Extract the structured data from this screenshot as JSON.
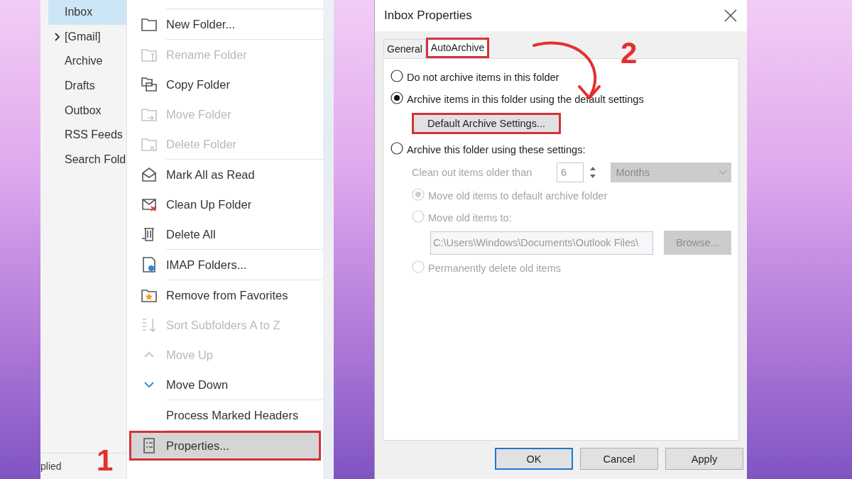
{
  "folder_pane": {
    "folders": [
      {
        "label": "Inbox",
        "selected": true,
        "kind": "folder"
      },
      {
        "label": "[Gmail]",
        "selected": false,
        "kind": "group"
      },
      {
        "label": "Archive",
        "selected": false,
        "kind": "folder"
      },
      {
        "label": "Drafts",
        "selected": false,
        "kind": "folder"
      },
      {
        "label": "Outbox",
        "selected": false,
        "kind": "folder"
      },
      {
        "label": "RSS Feeds",
        "selected": false,
        "kind": "folder"
      },
      {
        "label": "Search Fold",
        "selected": false,
        "kind": "folder"
      }
    ],
    "status_bar": "plied"
  },
  "context_menu": {
    "items": [
      {
        "label": "New Folder...",
        "disabled": false,
        "separator_before": true,
        "selected": false,
        "marked": false
      },
      {
        "label": "Rename Folder",
        "disabled": true,
        "separator_before": true,
        "selected": false,
        "marked": false
      },
      {
        "label": "Copy Folder",
        "disabled": false,
        "separator_before": false,
        "selected": false,
        "marked": false
      },
      {
        "label": "Move Folder",
        "disabled": true,
        "separator_before": false,
        "selected": false,
        "marked": false
      },
      {
        "label": "Delete Folder",
        "disabled": true,
        "separator_before": false,
        "selected": false,
        "marked": false
      },
      {
        "label": "Mark All as Read",
        "disabled": false,
        "separator_before": true,
        "selected": false,
        "marked": false
      },
      {
        "label": "Clean Up Folder",
        "disabled": false,
        "separator_before": false,
        "selected": false,
        "marked": false
      },
      {
        "label": "Delete All",
        "disabled": false,
        "separator_before": false,
        "selected": false,
        "marked": false
      },
      {
        "label": "IMAP Folders...",
        "disabled": false,
        "separator_before": true,
        "selected": false,
        "marked": false
      },
      {
        "label": "Remove from Favorites",
        "disabled": false,
        "separator_before": true,
        "selected": false,
        "marked": false
      },
      {
        "label": "Sort Subfolders A to Z",
        "disabled": true,
        "separator_before": false,
        "selected": false,
        "marked": false
      },
      {
        "label": "Move Up",
        "disabled": true,
        "separator_before": false,
        "selected": false,
        "marked": false
      },
      {
        "label": "Move Down",
        "disabled": false,
        "separator_before": false,
        "selected": false,
        "marked": false
      },
      {
        "label": "Process Marked Headers",
        "disabled": false,
        "separator_before": true,
        "selected": false,
        "marked": false
      },
      {
        "label": "Properties...",
        "disabled": false,
        "separator_before": true,
        "selected": true,
        "marked": true
      }
    ]
  },
  "dialog": {
    "title": "Inbox Properties",
    "tabs": [
      {
        "label": "General",
        "selected": false,
        "marked": false
      },
      {
        "label": "AutoArchive",
        "selected": true,
        "marked": true
      }
    ],
    "options": [
      {
        "label": "Do not archive items in this folder",
        "selected": false
      },
      {
        "label": "Archive items in this folder using the default settings",
        "selected": true
      },
      {
        "label": "Archive this folder using these settings:",
        "selected": false
      }
    ],
    "default_settings_button": {
      "label": "Default Archive Settings...",
      "marked": true
    },
    "clean_out": {
      "label": "Clean out items older than",
      "value": "6",
      "unit": "Months",
      "disabled": true
    },
    "destination_options": [
      {
        "label": "Move old items to default archive folder",
        "selected": true,
        "disabled": true
      },
      {
        "label": "Move old items to:",
        "selected": false,
        "disabled": true
      }
    ],
    "path_field": {
      "value": "C:\\Users\\Windows\\Documents\\Outlook Files\\",
      "disabled": true
    },
    "browse_button": {
      "label": "Browse...",
      "disabled": true
    },
    "delete_option": {
      "label": "Permanently delete old items",
      "selected": false,
      "disabled": true
    },
    "buttons": [
      {
        "label": "OK",
        "default": true
      },
      {
        "label": "Cancel",
        "default": false
      },
      {
        "label": "Apply",
        "default": false
      }
    ]
  },
  "annotations": [
    {
      "label": "1"
    },
    {
      "label": "2"
    }
  ]
}
